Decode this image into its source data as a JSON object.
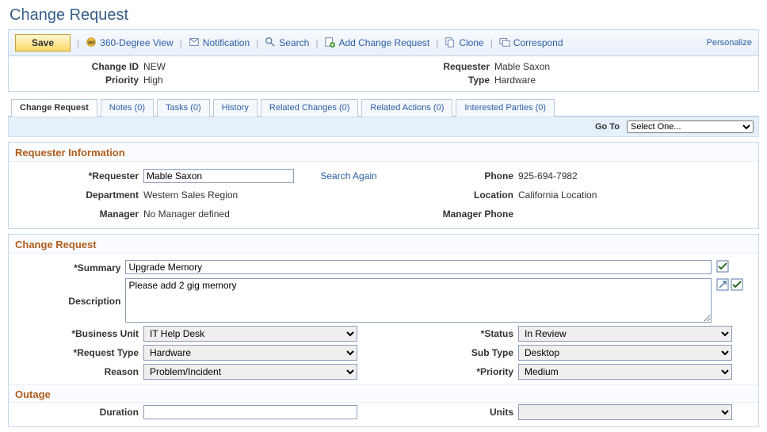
{
  "page_title": "Change Request",
  "toolbar": {
    "save_label": "Save",
    "view360_label": "360-Degree View",
    "notification_label": "Notification",
    "search_label": "Search",
    "add_label": "Add Change Request",
    "clone_label": "Clone",
    "correspond_label": "Correspond",
    "personalize_label": "Personalize"
  },
  "header": {
    "change_id_label": "Change ID",
    "change_id": "NEW",
    "priority_label": "Priority",
    "priority": "High",
    "requester_label": "Requester",
    "requester": "Mable Saxon",
    "type_label": "Type",
    "type": "Hardware"
  },
  "tabs": {
    "change_request": "Change Request",
    "notes": "Notes (0)",
    "tasks": "Tasks (0)",
    "history": "History",
    "related_changes": "Related Changes (0)",
    "related_actions": "Related Actions (0)",
    "interested_parties": "Interested Parties (0)"
  },
  "goto": {
    "label": "Go To",
    "selected": "Select One..."
  },
  "requester_info": {
    "title": "Requester Information",
    "requester_label": "*Requester",
    "requester_value": "Mable Saxon",
    "search_again": "Search Again",
    "phone_label": "Phone",
    "phone_value": "925-694-7982",
    "department_label": "Department",
    "department_value": "Western Sales Region",
    "location_label": "Location",
    "location_value": "California Location",
    "manager_label": "Manager",
    "manager_value": "No Manager defined",
    "manager_phone_label": "Manager Phone",
    "manager_phone_value": ""
  },
  "change_request": {
    "title": "Change Request",
    "summary_label": "*Summary",
    "summary_value": "Upgrade Memory",
    "description_label": "Description",
    "description_value": "Please add 2 gig memory",
    "business_unit_label": "*Business Unit",
    "business_unit_value": "IT Help Desk",
    "request_type_label": "*Request Type",
    "request_type_value": "Hardware",
    "reason_label": "Reason",
    "reason_value": "Problem/Incident",
    "status_label": "*Status",
    "status_value": "In Review",
    "sub_type_label": "Sub Type",
    "sub_type_value": "Desktop",
    "priority_label": "*Priority",
    "priority_value": "Medium"
  },
  "outage": {
    "title": "Outage",
    "duration_label": "Duration",
    "duration_value": "",
    "units_label": "Units",
    "units_value": ""
  }
}
